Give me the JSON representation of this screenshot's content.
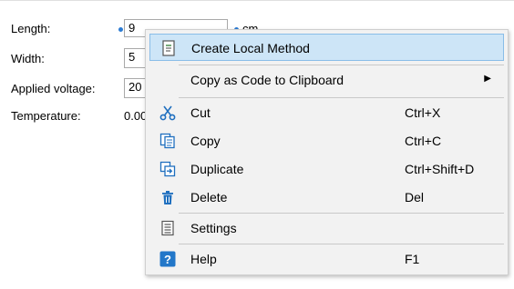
{
  "form": {
    "length": {
      "label": "Length:",
      "value": "9",
      "unit": "cm"
    },
    "width": {
      "label": "Width:",
      "value": "5"
    },
    "voltage": {
      "label": "Applied voltage:",
      "value": "20"
    },
    "temperature": {
      "label": "Temperature:",
      "value": "0.00"
    }
  },
  "context_menu": {
    "items": [
      {
        "label": "Create Local Method",
        "shortcut": "",
        "icon": "local-method-icon",
        "highlighted": true
      },
      {
        "label": "Copy as Code to Clipboard",
        "shortcut": "",
        "icon": "",
        "submenu": true
      },
      {
        "label": "Cut",
        "shortcut": "Ctrl+X",
        "icon": "scissors-icon"
      },
      {
        "label": "Copy",
        "shortcut": "Ctrl+C",
        "icon": "copy-icon"
      },
      {
        "label": "Duplicate",
        "shortcut": "Ctrl+Shift+D",
        "icon": "duplicate-icon"
      },
      {
        "label": "Delete",
        "shortcut": "Del",
        "icon": "trash-icon"
      },
      {
        "label": "Settings",
        "shortcut": "",
        "icon": "settings-icon"
      },
      {
        "label": "Help",
        "shortcut": "F1",
        "icon": "help-icon"
      }
    ],
    "submenu_arrow": "▶",
    "colors": {
      "highlight": "#cde5f7",
      "highlight_border": "#89bde8",
      "icon_blue": "#1f6fbf"
    }
  }
}
